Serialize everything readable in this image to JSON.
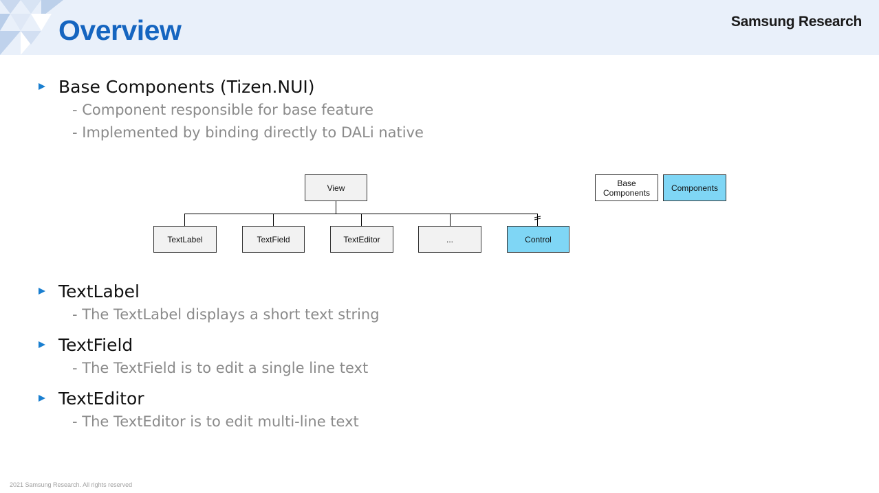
{
  "slide": {
    "title": "Overview",
    "brand": "Samsung Research",
    "footer": "2021 Samsung Research. All rights reserved"
  },
  "sections": [
    {
      "heading": "Base Components (Tizen.NUI)",
      "details": [
        "- Component responsible for base feature",
        "- Implemented by binding directly to DALi native"
      ]
    },
    {
      "heading": "TextLabel",
      "details": [
        "- The TextLabel displays a short text string"
      ]
    },
    {
      "heading": "TextField",
      "details": [
        "- The TextField is to edit a single line text"
      ]
    },
    {
      "heading": "TextEditor",
      "details": [
        "- The TextEditor is to edit multi-line text"
      ]
    }
  ],
  "diagram": {
    "root": "View",
    "children": [
      "TextLabel",
      "TextField",
      "TextEditor",
      "...",
      "Control"
    ],
    "legend": {
      "base": "Base\nComponents",
      "components": "Components"
    },
    "colors": {
      "base_fill": "#f2f2f2",
      "components_fill": "#7fd6f5",
      "accent": "#1565c0"
    }
  }
}
